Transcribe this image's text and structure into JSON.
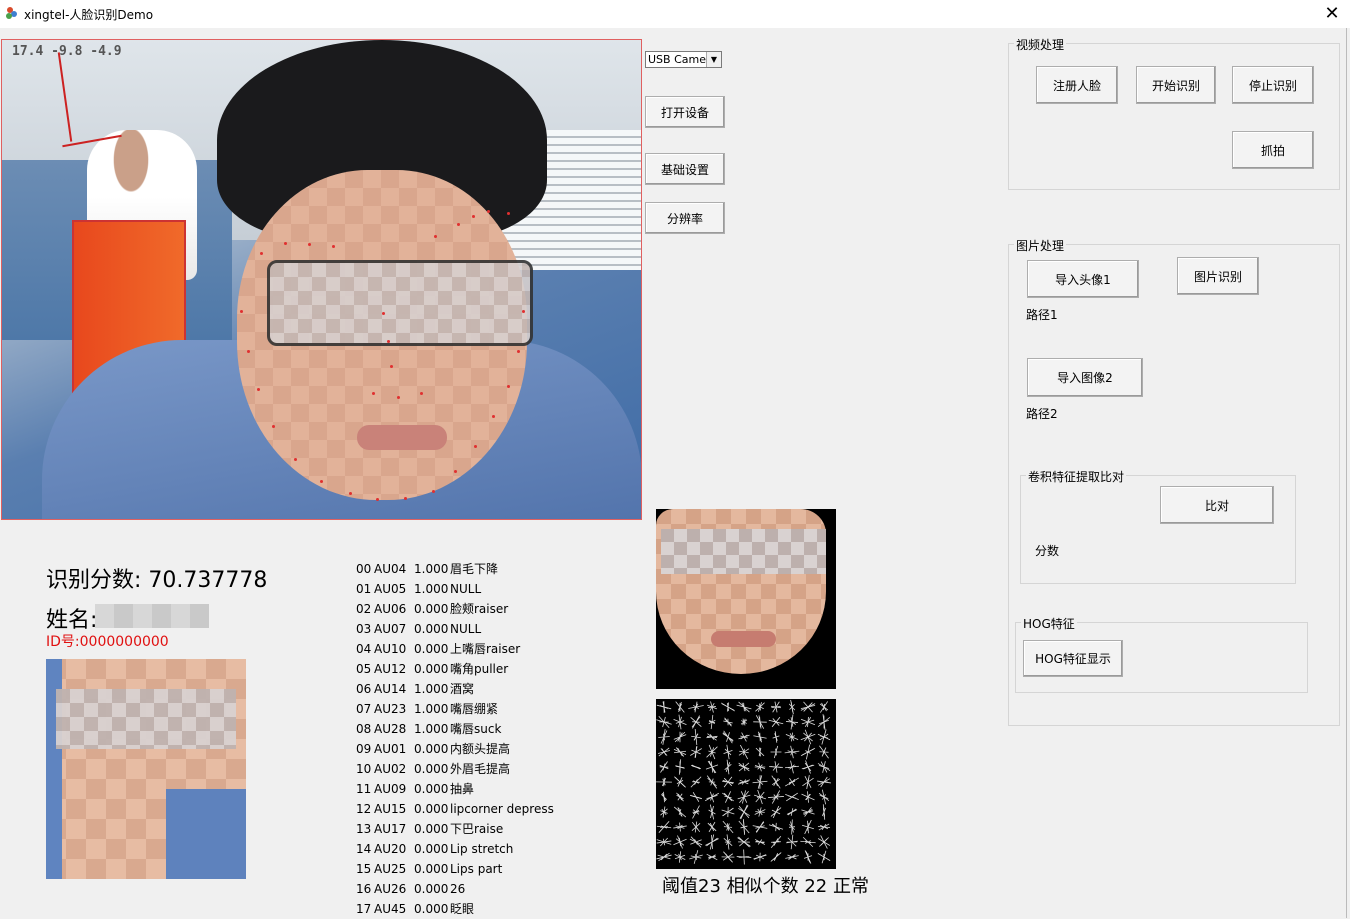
{
  "window": {
    "title": "xingtel-人脸识别Demo",
    "close_glyph": "✕"
  },
  "video": {
    "angle_readout": "17.4 -9.8 -4.9"
  },
  "controls": {
    "camera_select": "USB Camera",
    "open_device": "打开设备",
    "basic_settings": "基础设置",
    "resolution": "分辨率"
  },
  "video_group": {
    "title": "视频处理",
    "register_face": "注册人脸",
    "start_recognition": "开始识别",
    "stop_recognition": "停止识别",
    "capture": "抓拍"
  },
  "image_group": {
    "title": "图片处理",
    "import_avatar1": "导入头像1",
    "image_recognition": "图片识别",
    "path1": "路径1",
    "import_image2": "导入图像2",
    "path2": "路径2",
    "conv_group": {
      "title": "卷积特征提取比对",
      "compare": "比对",
      "score_label": "分数"
    },
    "hog_group": {
      "title": "HOG特征",
      "show_button": "HOG特征显示"
    }
  },
  "result": {
    "score_text": "识别分数: 70.737778",
    "name_label": "姓名:",
    "id_text": "ID号:0000000000"
  },
  "status_line": "阈值23  相似个数 22 正常",
  "au_list": [
    {
      "idx": "00",
      "code": "AU04",
      "value": "1.000",
      "desc": "眉毛下降"
    },
    {
      "idx": "01",
      "code": "AU05",
      "value": "1.000",
      "desc": "NULL"
    },
    {
      "idx": "02",
      "code": "AU06",
      "value": "0.000",
      "desc": "脸颊raiser"
    },
    {
      "idx": "03",
      "code": "AU07",
      "value": "0.000",
      "desc": "NULL"
    },
    {
      "idx": "04",
      "code": "AU10",
      "value": "0.000",
      "desc": "上嘴唇raiser"
    },
    {
      "idx": "05",
      "code": "AU12",
      "value": "0.000",
      "desc": "嘴角puller"
    },
    {
      "idx": "06",
      "code": "AU14",
      "value": "1.000",
      "desc": "酒窝"
    },
    {
      "idx": "07",
      "code": "AU23",
      "value": "1.000",
      "desc": "嘴唇绷紧"
    },
    {
      "idx": "08",
      "code": "AU28",
      "value": "1.000",
      "desc": "嘴唇suck"
    },
    {
      "idx": "09",
      "code": "AU01",
      "value": "0.000",
      "desc": "内额头提高"
    },
    {
      "idx": "10",
      "code": "AU02",
      "value": "0.000",
      "desc": "外眉毛提高"
    },
    {
      "idx": "11",
      "code": "AU09",
      "value": "0.000",
      "desc": "抽鼻"
    },
    {
      "idx": "12",
      "code": "AU15",
      "value": "0.000",
      "desc": "lipcorner depress"
    },
    {
      "idx": "13",
      "code": "AU17",
      "value": "0.000",
      "desc": "下巴raise"
    },
    {
      "idx": "14",
      "code": "AU20",
      "value": "0.000",
      "desc": "Lip stretch"
    },
    {
      "idx": "15",
      "code": "AU25",
      "value": "0.000",
      "desc": "Lips part"
    },
    {
      "idx": "16",
      "code": "AU26",
      "value": "0.000",
      "desc": "26"
    },
    {
      "idx": "17",
      "code": "AU45",
      "value": "0.000",
      "desc": "眨眼"
    }
  ],
  "colors": {
    "id_text": "#e01010",
    "landmarks": "#e03030",
    "background": "#f0f0f0"
  }
}
